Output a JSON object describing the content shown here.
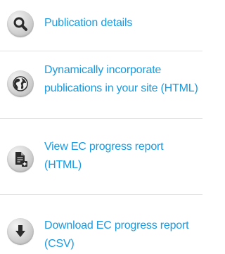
{
  "menu": {
    "items": [
      {
        "label": "Publication details",
        "icon": "search-icon"
      },
      {
        "label": "Dynamically incorporate publications in your site (HTML)",
        "icon": "globe-icon"
      },
      {
        "label": "View EC progress report (HTML)",
        "icon": "document-add-icon"
      },
      {
        "label": "Download EC progress report (CSV)",
        "icon": "download-arrow-icon"
      }
    ]
  },
  "colors": {
    "link": "#1a9ae0",
    "icon_bg": "#d8d8d8",
    "icon_glyph": "#2b2b2b",
    "divider": "#e3e3e3"
  }
}
